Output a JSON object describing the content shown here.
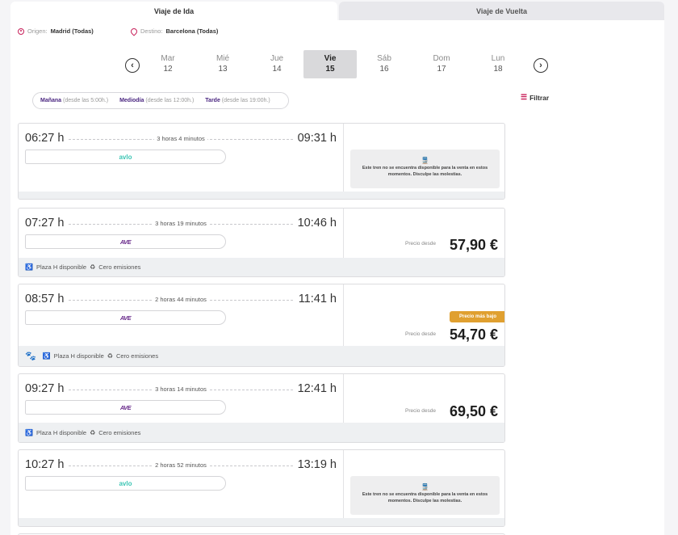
{
  "tabs": {
    "ida": "Viaje de Ida",
    "vuelta": "Viaje de Vuelta"
  },
  "route": {
    "origin_label": "Origen:",
    "origin_value": "Madrid (Todas)",
    "dest_label": "Destino:",
    "dest_value": "Barcelona (Todas)"
  },
  "days": [
    {
      "name": "Mar",
      "num": "12"
    },
    {
      "name": "Mié",
      "num": "13"
    },
    {
      "name": "Jue",
      "num": "14"
    },
    {
      "name": "Vie",
      "num": "15"
    },
    {
      "name": "Sáb",
      "num": "16"
    },
    {
      "name": "Dom",
      "num": "17"
    },
    {
      "name": "Lun",
      "num": "18"
    }
  ],
  "time_filters": [
    {
      "label": "Mañana",
      "hint": "(desde las 5:00h.)"
    },
    {
      "label": "Mediodía",
      "hint": "(desde las 12:00h.)"
    },
    {
      "label": "Tarde",
      "hint": "(desde las 19:00h.)"
    }
  ],
  "filter_label": "Filtrar",
  "price_from_label": "Precio desde",
  "cheapest_label": "Precio más bajo",
  "nosale_text": "Este tren no se encuentra disponible para la venta en estos momentos. Disculpe las molestias.",
  "footer_plaza": "Plaza H disponible",
  "footer_emisiones": "Cero emisiones",
  "trains": [
    {
      "dep": "06:27 h",
      "arr": "09:31 h",
      "duration": "3 horas 4 minutos",
      "brand": "avlo",
      "price": null
    },
    {
      "dep": "07:27 h",
      "arr": "10:46 h",
      "duration": "3 horas 19 minutos",
      "brand": "AVE",
      "price": "57,90 €"
    },
    {
      "dep": "08:57 h",
      "arr": "11:41 h",
      "duration": "2 horas 44 minutos",
      "brand": "AVE",
      "price": "54,70 €"
    },
    {
      "dep": "09:27 h",
      "arr": "12:41 h",
      "duration": "3 horas 14 minutos",
      "brand": "AVE",
      "price": "69,50 €"
    },
    {
      "dep": "10:27 h",
      "arr": "13:19 h",
      "duration": "2 horas 52 minutos",
      "brand": "avlo",
      "price": null
    }
  ]
}
